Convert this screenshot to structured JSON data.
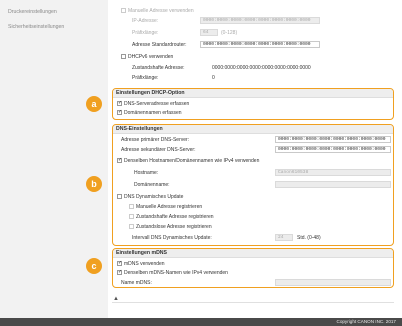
{
  "sidebar": {
    "items": [
      {
        "label": "Druckereinstellungen"
      },
      {
        "label": "Sicherheitseinstellungen"
      }
    ]
  },
  "ipv6_top": {
    "manual_checkbox_label": "Manuelle Adresse verwenden",
    "ip_label": "IP-Adresse:",
    "ip_value": "0000:0000:0000:0000:0000:0000:0000:0000",
    "prefix_label": "Präfixlänge:",
    "prefix_value": "64",
    "prefix_range": "(0-128)",
    "router_label": "Adresse Standardrouter:",
    "router_value": "0000:0000:0000:0000:0000:0000:0000:0000",
    "dhcp_label": "DHCPv6 verwenden",
    "stateful_label": "Zustandshafte Adresse:",
    "stateful_value": "0000:0000:0000:0000:0000:0000:0000:0000",
    "prefix2_label": "Präfixlänge:",
    "prefix2_value": "0"
  },
  "dhcp_section": {
    "title": "Einstellungen DHCP-Option",
    "badge": "a",
    "items": [
      {
        "label": "DNS-Serveradresse erfassen",
        "checked": true
      },
      {
        "label": "Domänennamen erfassen",
        "checked": true
      }
    ]
  },
  "dns_section": {
    "title": "DNS-Einstellungen",
    "badge": "b",
    "primary_label": "Adresse primärer DNS-Server:",
    "primary_value": "0000:0000:0000:0000:0000:0000:0000:0000",
    "secondary_label": "Adresse sekundärer DNS-Server:",
    "secondary_value": "0000:0000:0000:0000:0000:0000:0000:0000",
    "same_host_label": "Denselben Hostnamen/Domänennamen wie IPv4 verwenden",
    "hostname_label": "Hostname:",
    "hostname_value": "Canon610538",
    "domain_label": "Domänenname:",
    "domain_value": "",
    "dyn_update_label": "DNS Dynamisches Update",
    "manual_reg_label": "Manuelle Adresse registrieren",
    "stateful_reg_label": "Zustandshafte Adresse registrieren",
    "stateless_reg_label": "Zustandslose Adresse registrieren",
    "interval_label": "Intervall DNS Dynamisches Update:",
    "interval_value": "24",
    "interval_unit": "Std. (0-48)"
  },
  "mdns_section": {
    "title": "Einstellungen mDNS",
    "badge": "c",
    "use_label": "mDNS verwenden",
    "same_name_label": "Denselben mDNS-Namen wie IPv4 verwenden",
    "name_label": "Name mDNS:",
    "name_value": ""
  },
  "top_arrow": "▲",
  "footer": {
    "copyright": "Copyright CANON INC. 2017"
  },
  "colors": {
    "accent": "#f0a020",
    "footer": "#4a4a4a",
    "sidebar": "#f2f2f2"
  }
}
